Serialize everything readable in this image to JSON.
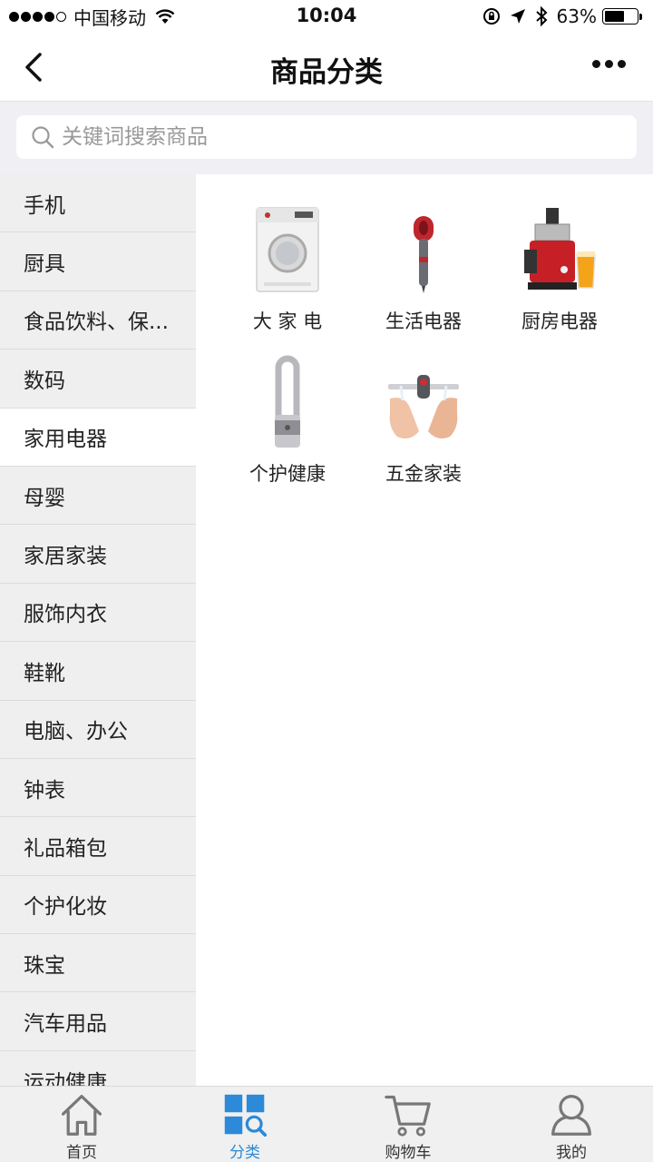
{
  "status_bar": {
    "carrier": "中国移动",
    "time": "10:04",
    "battery": "63%",
    "battery_level": 0.63
  },
  "nav": {
    "title": "商品分类"
  },
  "search": {
    "placeholder": "关键词搜索商品"
  },
  "sidebar": {
    "items": [
      {
        "label": "手机"
      },
      {
        "label": "厨具"
      },
      {
        "label": "食品饮料、保..."
      },
      {
        "label": "数码"
      },
      {
        "label": "家用电器"
      },
      {
        "label": "母婴"
      },
      {
        "label": "家居家装"
      },
      {
        "label": "服饰内衣"
      },
      {
        "label": "鞋靴"
      },
      {
        "label": "电脑、办公"
      },
      {
        "label": "钟表"
      },
      {
        "label": "礼品箱包"
      },
      {
        "label": "个护化妆"
      },
      {
        "label": "珠宝"
      },
      {
        "label": "汽车用品"
      },
      {
        "label": "运动健康"
      }
    ],
    "active_index": 4
  },
  "content": {
    "items": [
      {
        "label": "大 家 电",
        "icon": "washing-machine-icon"
      },
      {
        "label": "生活电器",
        "icon": "hair-dryer-icon"
      },
      {
        "label": "厨房电器",
        "icon": "juicer-icon"
      },
      {
        "label": "个护健康",
        "icon": "air-purifier-icon"
      },
      {
        "label": "五金家装",
        "icon": "hand-dryer-icon"
      }
    ]
  },
  "tab_bar": {
    "tabs": [
      {
        "label": "首页",
        "icon": "home-icon"
      },
      {
        "label": "分类",
        "icon": "category-icon"
      },
      {
        "label": "购物车",
        "icon": "cart-icon"
      },
      {
        "label": "我的",
        "icon": "user-icon"
      }
    ],
    "active_index": 1,
    "active_color": "#2c8ad8"
  }
}
